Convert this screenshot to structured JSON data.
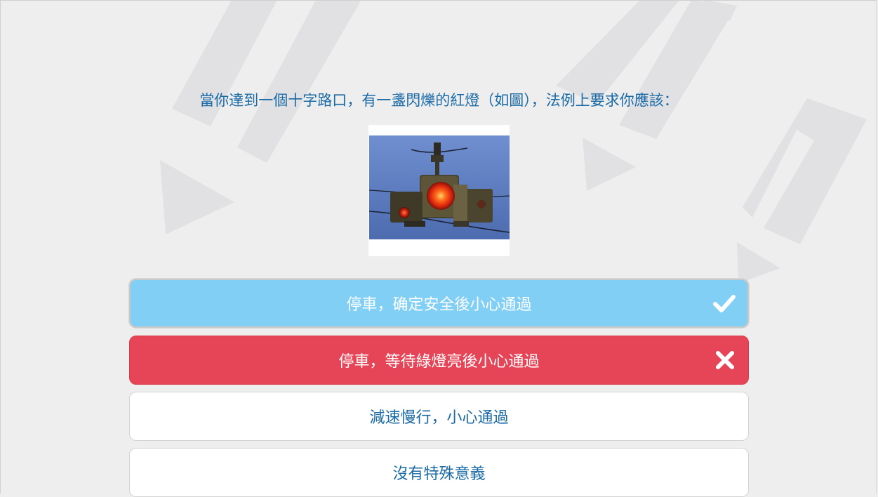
{
  "quiz": {
    "question": "當你達到一個十字路口，有一盞閃爍的紅燈（如圖），法例上要求你應該：",
    "image_icon": "flashing-red-traffic-light-image",
    "options": [
      {
        "label": "停車，确定安全後小心通過",
        "state": "correct",
        "mark_icon": "check-icon"
      },
      {
        "label": "停車，等待綠燈亮後小心通過",
        "state": "wrong",
        "mark_icon": "cross-icon"
      },
      {
        "label": "減速慢行，小心通過",
        "state": "unselected"
      },
      {
        "label": "沒有特殊意義",
        "state": "unselected"
      }
    ]
  },
  "colors": {
    "question_text": "#1a6aa6",
    "correct_bg": "#81cff4",
    "wrong_bg": "#e64557",
    "plain_bg": "#ffffff",
    "page_bg": "#eeeeee"
  }
}
